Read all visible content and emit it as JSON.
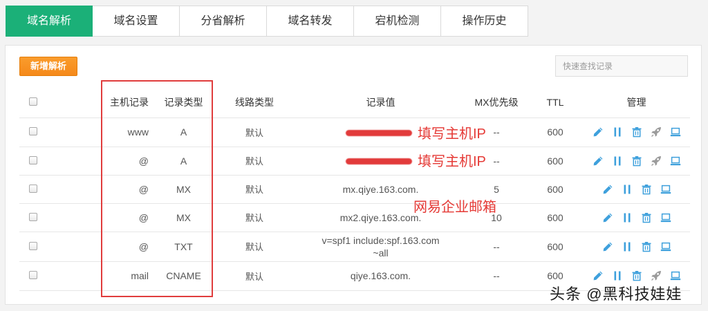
{
  "colors": {
    "accent": "#1bb078",
    "add_button": "#f5891a",
    "action_icon": "#3ea0dc",
    "annotation": "#e53935"
  },
  "tabs": [
    {
      "label": "域名解析",
      "active": true
    },
    {
      "label": "域名设置",
      "active": false
    },
    {
      "label": "分省解析",
      "active": false
    },
    {
      "label": "域名转发",
      "active": false
    },
    {
      "label": "宕机检测",
      "active": false
    },
    {
      "label": "操作历史",
      "active": false
    }
  ],
  "toolbar": {
    "add_label": "新增解析",
    "search_placeholder": "快速查找记录"
  },
  "table": {
    "headers": {
      "host": "主机记录",
      "type": "记录类型",
      "line": "线路类型",
      "value": "记录值",
      "mx": "MX优先级",
      "ttl": "TTL",
      "manage": "管理"
    },
    "rows": [
      {
        "host": "www",
        "type": "A",
        "line": "默认",
        "mx": "--",
        "ttl": "600",
        "actions": [
          "edit-icon",
          "pause-icon",
          "delete-icon",
          "rocket-icon",
          "monitor-icon"
        ]
      },
      {
        "host": "@",
        "type": "A",
        "line": "默认",
        "mx": "--",
        "ttl": "600",
        "actions": [
          "edit-icon",
          "pause-icon",
          "delete-icon",
          "rocket-icon",
          "monitor-icon"
        ]
      },
      {
        "host": "@",
        "type": "MX",
        "line": "默认",
        "value": "mx.qiye.163.com.",
        "mx": "5",
        "ttl": "600",
        "actions": [
          "edit-icon",
          "pause-icon",
          "delete-icon",
          "monitor-icon"
        ]
      },
      {
        "host": "@",
        "type": "MX",
        "line": "默认",
        "value": "mx2.qiye.163.com.",
        "mx": "10",
        "ttl": "600",
        "actions": [
          "edit-icon",
          "pause-icon",
          "delete-icon",
          "monitor-icon"
        ]
      },
      {
        "host": "@",
        "type": "TXT",
        "line": "默认",
        "value": "v=spf1 include:spf.163.com ~all",
        "mx": "--",
        "ttl": "600",
        "actions": [
          "edit-icon",
          "pause-icon",
          "delete-icon",
          "monitor-icon"
        ]
      },
      {
        "host": "mail",
        "type": "CNAME",
        "line": "默认",
        "value": "qiye.163.com.",
        "mx": "--",
        "ttl": "600",
        "actions": [
          "edit-icon",
          "pause-icon",
          "delete-icon",
          "rocket-icon",
          "monitor-icon"
        ]
      }
    ]
  },
  "annotations": [
    "填写主机IP",
    "填写主机IP",
    "网易企业邮箱"
  ],
  "watermark": "头条 @黑科技娃娃"
}
